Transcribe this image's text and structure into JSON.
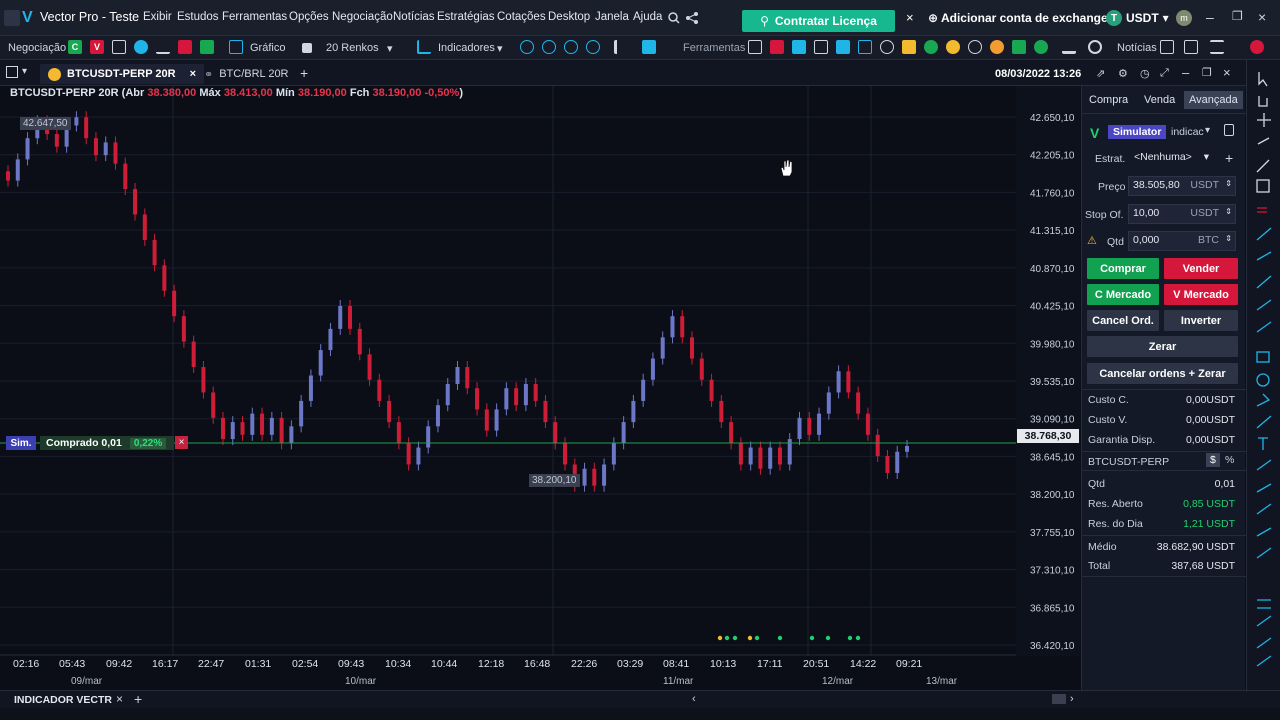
{
  "menubar": {
    "app_title": "Vector Pro - Teste",
    "items": [
      "Exibir",
      "Estudos",
      "Ferramentas",
      "Opções",
      "Negociação",
      "Notícias",
      "Estratégias",
      "Cotações",
      "Desktop",
      "Janela",
      "Ajuda"
    ],
    "license_button": "Contratar Licença",
    "exchange_button": "Adicionar conta de exchange",
    "currency": "USDT",
    "coin_letter": "T"
  },
  "toolbar": {
    "negociacao": "Negociação",
    "c_label": "C",
    "v_label": "V",
    "grafico": "Gráfico",
    "renkos": "20 Renkos",
    "indicadores": "Indicadores",
    "ferramentas": "Ferramentas",
    "noticias": "Notícias"
  },
  "tabs": {
    "items": [
      {
        "label": "BTCUSDT-PERP 20R",
        "active": true
      },
      {
        "label": "BTC/BRL 20R",
        "active": false
      }
    ],
    "datetime": "08/03/2022 13:26"
  },
  "chart_header": {
    "symbol": "BTCUSDT-PERP 20R",
    "abr_label": "Abr",
    "abr": "38.380,00",
    "max_label": "Máx",
    "max": "38.413,00",
    "min_label": "Mín",
    "min": "38.190,00",
    "fch_label": "Fch",
    "fch": "38.190,00",
    "change": "-0,50%"
  },
  "chart_data": {
    "type": "renko",
    "y_ticks": [
      "42.650,10",
      "42.205,10",
      "41.760,10",
      "41.315,10",
      "40.870,10",
      "40.425,10",
      "39.980,10",
      "39.535,10",
      "39.090,10",
      "38.645,10",
      "38.200,10",
      "37.755,10",
      "37.310,10",
      "36.865,10",
      "36.420,10"
    ],
    "ylim": [
      36420.1,
      42650.1
    ],
    "x_time_ticks": [
      "02:16",
      "05:43",
      "09:42",
      "16:17",
      "22:47",
      "01:31",
      "02:54",
      "09:43",
      "10:34",
      "10:44",
      "12:18",
      "16:48",
      "22:26",
      "03:29",
      "08:41",
      "10:13",
      "17:11",
      "20:51",
      "14:22",
      "09:21"
    ],
    "x_date_ticks": [
      "09/mar",
      "10/mar",
      "11/mar",
      "12/mar",
      "13/mar"
    ],
    "current_price": "38.768,30",
    "high_label": "42.647,50",
    "low_label": "38.200,10",
    "closes": [
      41900,
      42150,
      42400,
      42600,
      42450,
      42300,
      42550,
      42647,
      42400,
      42200,
      42350,
      42100,
      41800,
      41500,
      41200,
      40900,
      40600,
      40300,
      40000,
      39700,
      39400,
      39100,
      38850,
      39050,
      38900,
      39150,
      38900,
      39100,
      38800,
      39000,
      39300,
      39600,
      39900,
      40150,
      40420,
      40150,
      39850,
      39550,
      39300,
      39050,
      38800,
      38550,
      38750,
      39000,
      39250,
      39500,
      39700,
      39450,
      39200,
      38950,
      39200,
      39450,
      39250,
      39500,
      39300,
      39050,
      38800,
      38550,
      38300,
      38500,
      38300,
      38550,
      38800,
      39050,
      39300,
      39550,
      39800,
      40050,
      40300,
      40050,
      39800,
      39550,
      39300,
      39050,
      38800,
      38550,
      38750,
      38500,
      38750,
      38550,
      38850,
      39100,
      38900,
      39150,
      39400,
      39650,
      39400,
      39150,
      38900,
      38650,
      38450,
      38700,
      38768
    ],
    "colors": {
      "up": "#6d77c7",
      "down": "#d01d37",
      "position_line": "#1fa04a",
      "grid": "#1a1f2d"
    }
  },
  "position": {
    "sim_label": "Sim.",
    "text": "Comprado 0,01",
    "pct": "0,22%",
    "close_icon": "×"
  },
  "panel": {
    "tabs": [
      "Compra",
      "Venda",
      "Avançada"
    ],
    "simulator": "Simulator",
    "simulator_extra": "indicac",
    "estrat_label": "Estrat.",
    "estrat_value": "<Nenhuma>",
    "preco_label": "Preço",
    "preco_value": "38.505,80",
    "preco_unit": "USDT",
    "stop_label": "Stop Of.",
    "stop_value": "10,00",
    "stop_unit": "USDT",
    "qtd_label": "Qtd",
    "qtd_value": "0,000",
    "qtd_unit": "BTC",
    "btn_comprar": "Comprar",
    "btn_vender": "Vender",
    "btn_cmercado": "C Mercado",
    "btn_vmercado": "V Mercado",
    "btn_cancel": "Cancel Ord.",
    "btn_inverter": "Inverter",
    "btn_zerar": "Zerar",
    "btn_cancel_zerar": "Cancelar ordens + Zerar",
    "custo_c_label": "Custo C.",
    "custo_c": "0,00USDT",
    "custo_v_label": "Custo V.",
    "custo_v": "0,00USDT",
    "garantia_label": "Garantia Disp.",
    "garantia": "0,00USDT",
    "symbol": "BTCUSDT-PERP",
    "dollar": "$",
    "percent": "%",
    "qtd2_label": "Qtd",
    "qtd2": "0,01",
    "res_aberto_label": "Res. Aberto",
    "res_aberto": "0,85 USDT",
    "res_dia_label": "Res. do Dia",
    "res_dia": "1,21 USDT",
    "medio_label": "Médio",
    "medio": "38.682,90 USDT",
    "total_label": "Total",
    "total": "387,68 USDT"
  },
  "bottombar": {
    "indicator_tab": "INDICADOR VECTR"
  }
}
